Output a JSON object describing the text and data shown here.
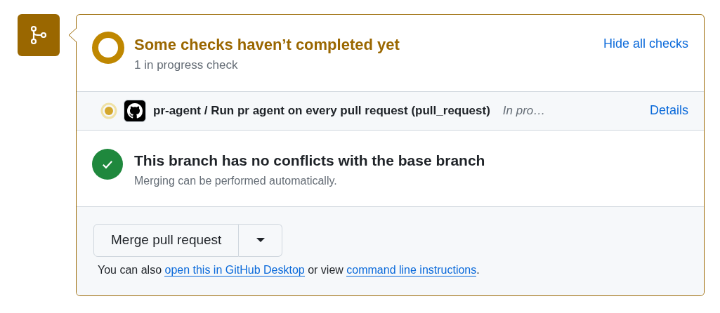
{
  "status_header": {
    "title": "Some checks haven’t completed yet",
    "subtitle": "1 in progress check",
    "toggle_link": "Hide all checks"
  },
  "checks": [
    {
      "kind": "pending",
      "name": "pr-agent / Run pr agent on every pull request (pull_request)",
      "state_text": "In pro…",
      "details_link": "Details"
    }
  ],
  "conflicts": {
    "ok": true,
    "title": "This branch has no conflicts with the base branch",
    "subtitle": "Merging can be performed automatically."
  },
  "merge": {
    "button": "Merge pull request",
    "note": [
      {
        "kind": "text",
        "text": "You can also "
      },
      {
        "kind": "link",
        "text": "open this in GitHub Desktop"
      },
      {
        "kind": "text",
        "text": " or view "
      },
      {
        "kind": "link",
        "text": "command line instructions"
      },
      {
        "kind": "text",
        "text": "."
      }
    ]
  }
}
